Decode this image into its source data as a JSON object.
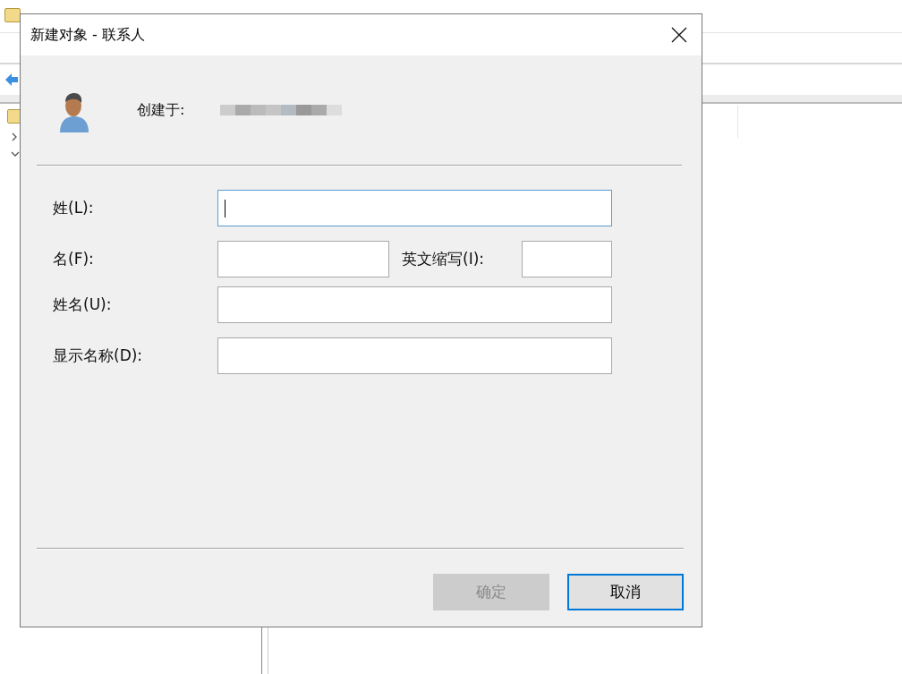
{
  "dialog": {
    "title": "新建对象 - 联系人",
    "created_in_label": "创建于:",
    "fields": [
      {
        "kind": "wide",
        "label": "姓(L):",
        "focused": true
      },
      {
        "kind": "pair",
        "label": "名(F):",
        "focused": false,
        "second_label": "英文缩写(I):"
      },
      {
        "kind": "wide",
        "label": "姓名(U):",
        "focused": false
      },
      {
        "kind": "wide",
        "label": "显示名称(D):",
        "focused": false
      }
    ],
    "buttons": [
      {
        "label": "确定",
        "disabled": true,
        "default": false
      },
      {
        "label": "取消",
        "disabled": false,
        "default": true
      }
    ]
  }
}
